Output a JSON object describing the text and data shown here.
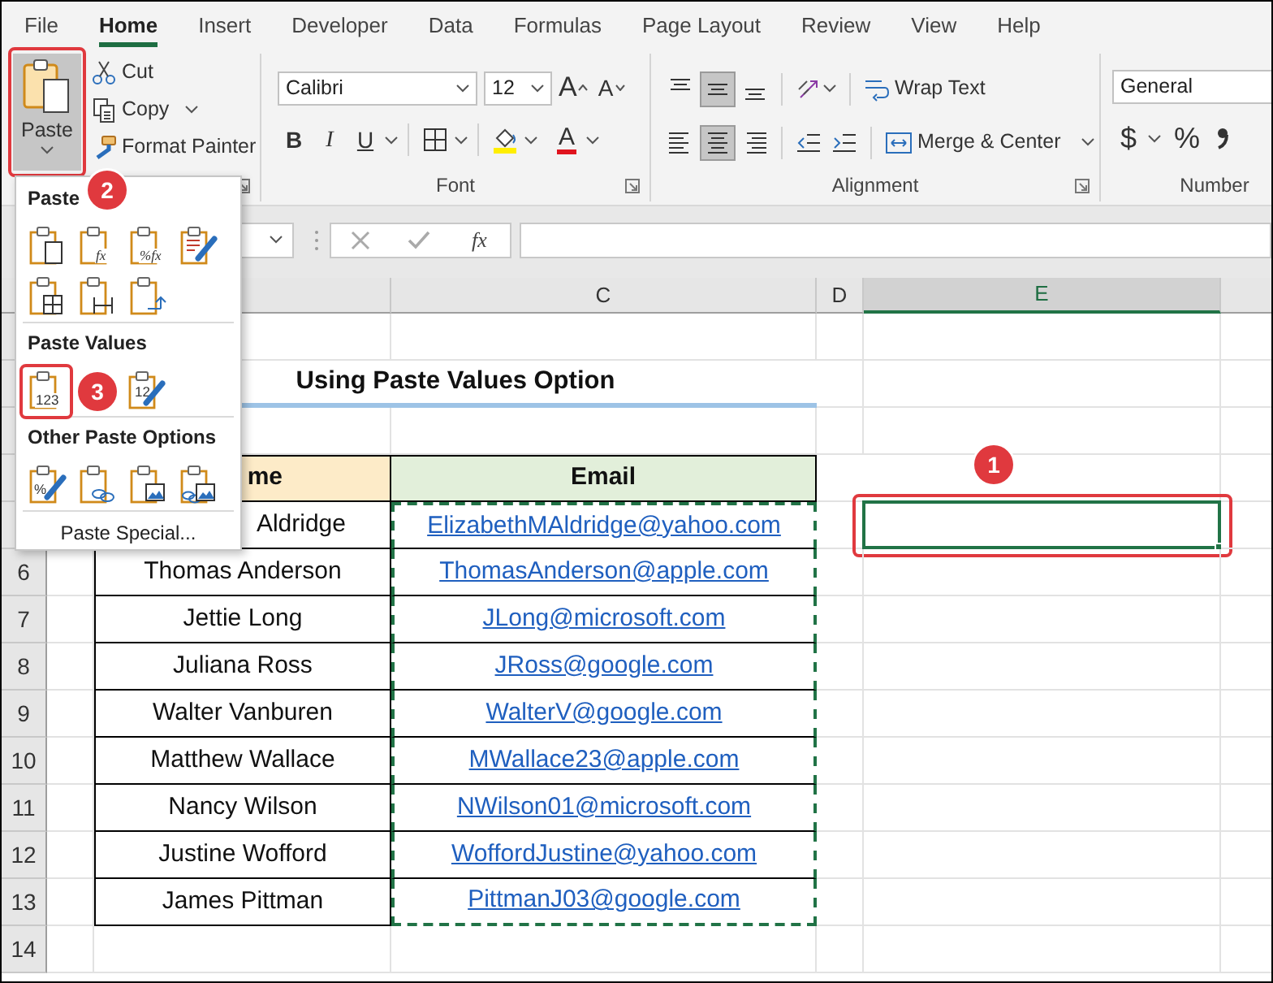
{
  "ribbon_tabs": [
    {
      "label": "File",
      "selected": false
    },
    {
      "label": "Home",
      "selected": true
    },
    {
      "label": "Insert",
      "selected": false
    },
    {
      "label": "Developer",
      "selected": false
    },
    {
      "label": "Data",
      "selected": false
    },
    {
      "label": "Formulas",
      "selected": false
    },
    {
      "label": "Page Layout",
      "selected": false
    },
    {
      "label": "Review",
      "selected": false
    },
    {
      "label": "View",
      "selected": false
    },
    {
      "label": "Help",
      "selected": false
    }
  ],
  "clipboard": {
    "paste_button": {
      "label": "Paste",
      "pressed": true,
      "highlighted": true,
      "callout": "2"
    },
    "commands": [
      {
        "kind": "cut",
        "label": "Cut"
      },
      {
        "kind": "copy",
        "label": "Copy"
      },
      {
        "kind": "painter",
        "label": "Format Painter"
      }
    ]
  },
  "font": {
    "font_name": "Calibri",
    "font_size": "12",
    "grow_font": "A",
    "shrink_font": "A",
    "styles": [
      "B",
      "I",
      "U"
    ],
    "font_color": "A",
    "label": "Font"
  },
  "alignment": {
    "vertical": [
      {
        "selected": false
      },
      {
        "selected": true
      },
      {
        "selected": false
      }
    ],
    "horizontal": [
      {
        "selected": false
      },
      {
        "selected": true
      },
      {
        "selected": false
      }
    ],
    "wrap_text": "Wrap Text",
    "merge_center": "Merge & Center",
    "label": "Alignment"
  },
  "number": {
    "format": "General",
    "currency": "$",
    "percent": "%",
    "label": "Number"
  },
  "formula_bar": {
    "function_button": "fx"
  },
  "paste_menu": {
    "sections": [
      {
        "heading": "Paste",
        "options": [
          {
            "kind": "plain",
            "highlighted": false
          },
          {
            "kind": "formulas",
            "glyph": "fx",
            "highlighted": false
          },
          {
            "kind": "numberformulas",
            "glyph": "%fx",
            "highlighted": false
          },
          {
            "kind": "sourceformat",
            "highlighted": false
          },
          {
            "kind": "noborders",
            "highlighted": false
          },
          {
            "kind": "colwidths",
            "highlighted": false
          },
          {
            "kind": "transpose",
            "highlighted": false
          }
        ]
      },
      {
        "heading": "Paste Values",
        "options": [
          {
            "kind": "values",
            "glyph": "123",
            "highlighted": true,
            "callout": "3"
          },
          {
            "kind": "valuesformat",
            "glyph": "12",
            "highlighted": false
          }
        ]
      },
      {
        "heading": "Other Paste Options",
        "options": [
          {
            "kind": "formatting",
            "glyph": "%",
            "highlighted": false
          },
          {
            "kind": "link",
            "highlighted": false
          },
          {
            "kind": "picture",
            "highlighted": false
          },
          {
            "kind": "linkedpicture",
            "highlighted": false
          }
        ]
      }
    ],
    "footer": "Paste Special..."
  },
  "sheet": {
    "columns": [
      {
        "label": "C",
        "selected": false
      },
      {
        "label": "D",
        "selected": false
      },
      {
        "label": "E",
        "selected": true
      }
    ],
    "row_numbers": [
      "6",
      "7",
      "8",
      "9",
      "10",
      "11",
      "12",
      "13",
      "14"
    ],
    "title": "Using Paste Values Option",
    "table": {
      "columns": [
        "me",
        "Email"
      ],
      "rows": [
        {
          "name": "Aldridge",
          "email": "ElizabethMAldridge@yahoo.com"
        },
        {
          "name": "Thomas Anderson",
          "email": "ThomasAnderson@apple.com"
        },
        {
          "name": "Jettie Long",
          "email": "JLong@microsoft.com"
        },
        {
          "name": "Juliana Ross",
          "email": "JRoss@google.com"
        },
        {
          "name": "Walter Vanburen",
          "email": "WalterV@google.com"
        },
        {
          "name": "Matthew Wallace",
          "email": "MWallace23@apple.com"
        },
        {
          "name": "Nancy Wilson",
          "email": "NWilson01@microsoft.com"
        },
        {
          "name": "Justine Wofford",
          "email": "WoffordJustine@yahoo.com"
        },
        {
          "name": "James Pittman",
          "email": "PittmanJ03@google.com"
        }
      ]
    },
    "selected_cell": {
      "highlighted": true,
      "callout": "1"
    }
  }
}
